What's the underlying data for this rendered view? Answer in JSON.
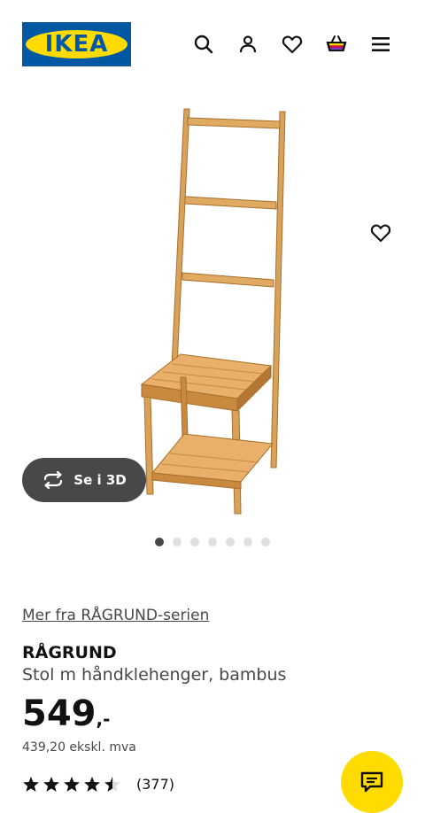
{
  "header": {
    "logo_text": "IKEA",
    "icons": [
      "search-icon",
      "user-icon",
      "heart-icon",
      "basket-icon",
      "menu-icon"
    ]
  },
  "gallery": {
    "view_3d_label": "Se i 3D",
    "image_count": 7,
    "active_index": 0
  },
  "product": {
    "series_link": "Mer fra RÅGRUND-serien",
    "name": "RÅGRUND",
    "description": "Stol m håndklehenger, bambus",
    "price": "549",
    "price_suffix": ",-",
    "price_ex_vat": "439,20 ekskl. mva",
    "rating_stars": 4.5,
    "rating_count": "(377)"
  },
  "colors": {
    "brand_blue": "#0058a3",
    "brand_yellow": "#ffdb00",
    "dark_button": "#484848"
  }
}
